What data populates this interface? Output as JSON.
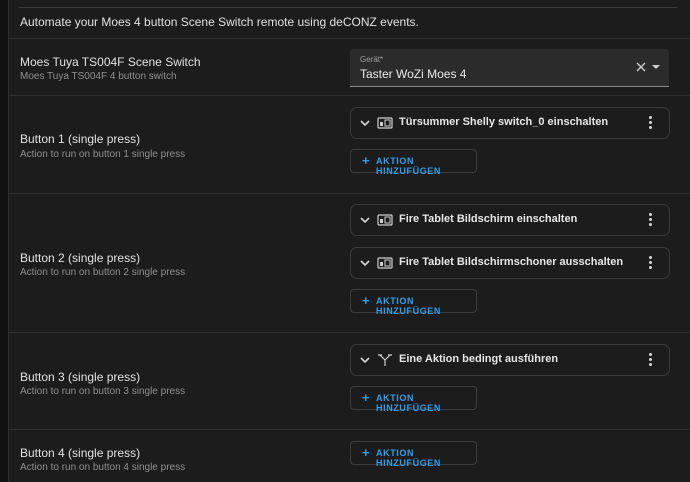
{
  "description": "Automate your Moes 4 button Scene Switch remote using deCONZ events.",
  "device_row": {
    "label": "Moes Tuya TS004F Scene Switch",
    "sublabel": "Moes Tuya TS004F 4 button switch",
    "select": {
      "field_label": "Gerät*",
      "value": "Taster WoZi Moes 4"
    }
  },
  "rows": [
    {
      "label": "Button 1 (single press)",
      "sublabel": "Action to run on button 1 single press",
      "actions": [
        {
          "text": "Türsummer Shelly switch_0 einschalten",
          "icon": "device-icon"
        }
      ],
      "add_label": "AKTION HINZUFÜGEN"
    },
    {
      "label": "Button 2 (single press)",
      "sublabel": "Action to run on button 2 single press",
      "actions": [
        {
          "text": "Fire Tablet Bildschirm einschalten",
          "icon": "device-icon"
        },
        {
          "text": "Fire Tablet Bildschirmschoner ausschalten",
          "icon": "device-icon"
        }
      ],
      "add_label": "AKTION HINZUFÜGEN"
    },
    {
      "label": "Button 3 (single press)",
      "sublabel": "Action to run on button 3 single press",
      "actions": [
        {
          "text": "Eine Aktion bedingt ausführen",
          "icon": "branch-icon"
        }
      ],
      "add_label": "AKTION HINZUFÜGEN"
    },
    {
      "label": "Button 4 (single press)",
      "sublabel": "Action to run on button 4 single press",
      "actions": [],
      "add_label": "AKTION HINZUFÜGEN"
    }
  ],
  "colors": {
    "accent": "#2f9fe8",
    "background": "#1c1c1c"
  }
}
